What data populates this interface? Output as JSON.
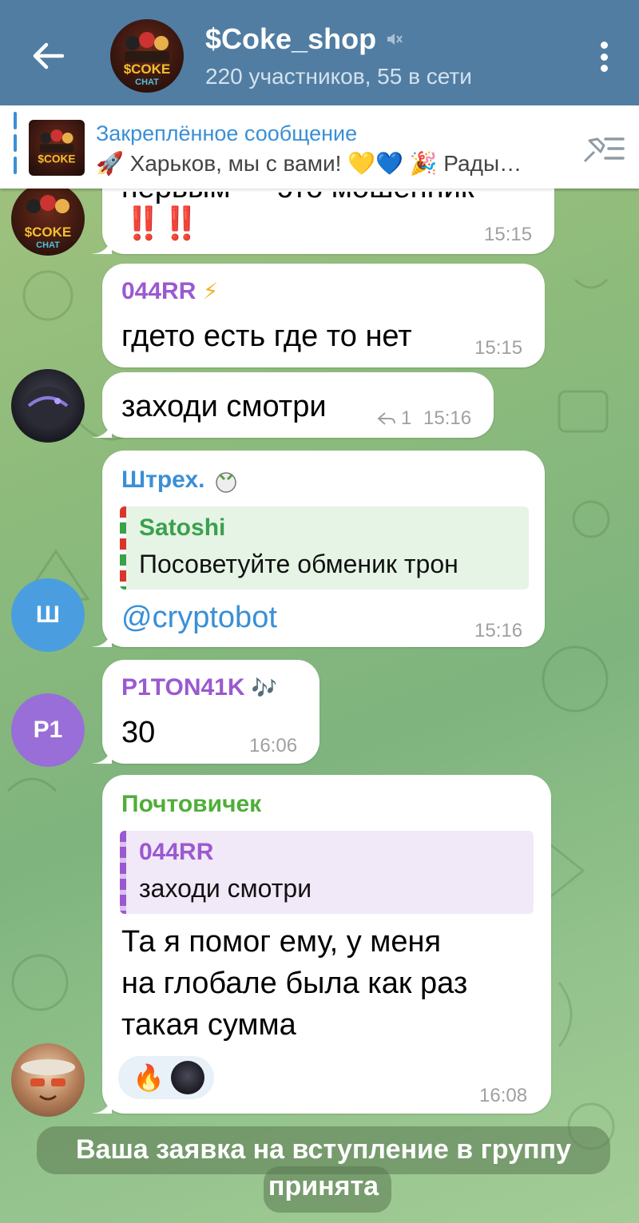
{
  "header": {
    "title": "$Coke_shop",
    "subtitle": "220 участников, 55 в сети"
  },
  "pinned": {
    "title": "Закреплённое сообщение",
    "text": "🚀 Харьков, мы с вами! 💛💙  🎉 Рады…"
  },
  "messages": [
    {
      "partial_text": "первым — это мошенник",
      "marks": "‼️‼️",
      "time": "15:15"
    },
    {
      "sender": "044RR",
      "sender_badge": "⚡",
      "text": "гдето есть где то нет",
      "time": "15:15"
    },
    {
      "text": "заходи смотри",
      "replies_count": "1",
      "time": "15:16"
    },
    {
      "sender": "Штрех.",
      "reply_name": "Satoshi",
      "reply_text": "Посоветуйте обменик трон",
      "text": "@cryptobot",
      "time": "15:16",
      "avatar_letter": "Ш"
    },
    {
      "sender": "P1TON41K",
      "sender_badge": "🎶",
      "text": "30",
      "time": "16:06",
      "avatar_letter": "P1"
    },
    {
      "sender": "Почтовичек",
      "reply_name": "044RR",
      "reply_text": "заходи смотри",
      "text_lines": [
        "Та я помог ему, у меня",
        "на глобале была как раз",
        "такая сумма"
      ],
      "reaction": "🔥",
      "time": "16:08"
    }
  ],
  "service": {
    "line1": "Ваша заявка на вступление в группу",
    "line2": "принята"
  },
  "colors": {
    "header_bg": "#517da2",
    "accent_blue": "#3a8fd6",
    "name_purple": "#9b59d0",
    "name_blue": "#3a8fd6",
    "name_green": "#4fae3a",
    "avatar_blue": "#4a9ee0",
    "avatar_purple": "#9a6ed8"
  }
}
